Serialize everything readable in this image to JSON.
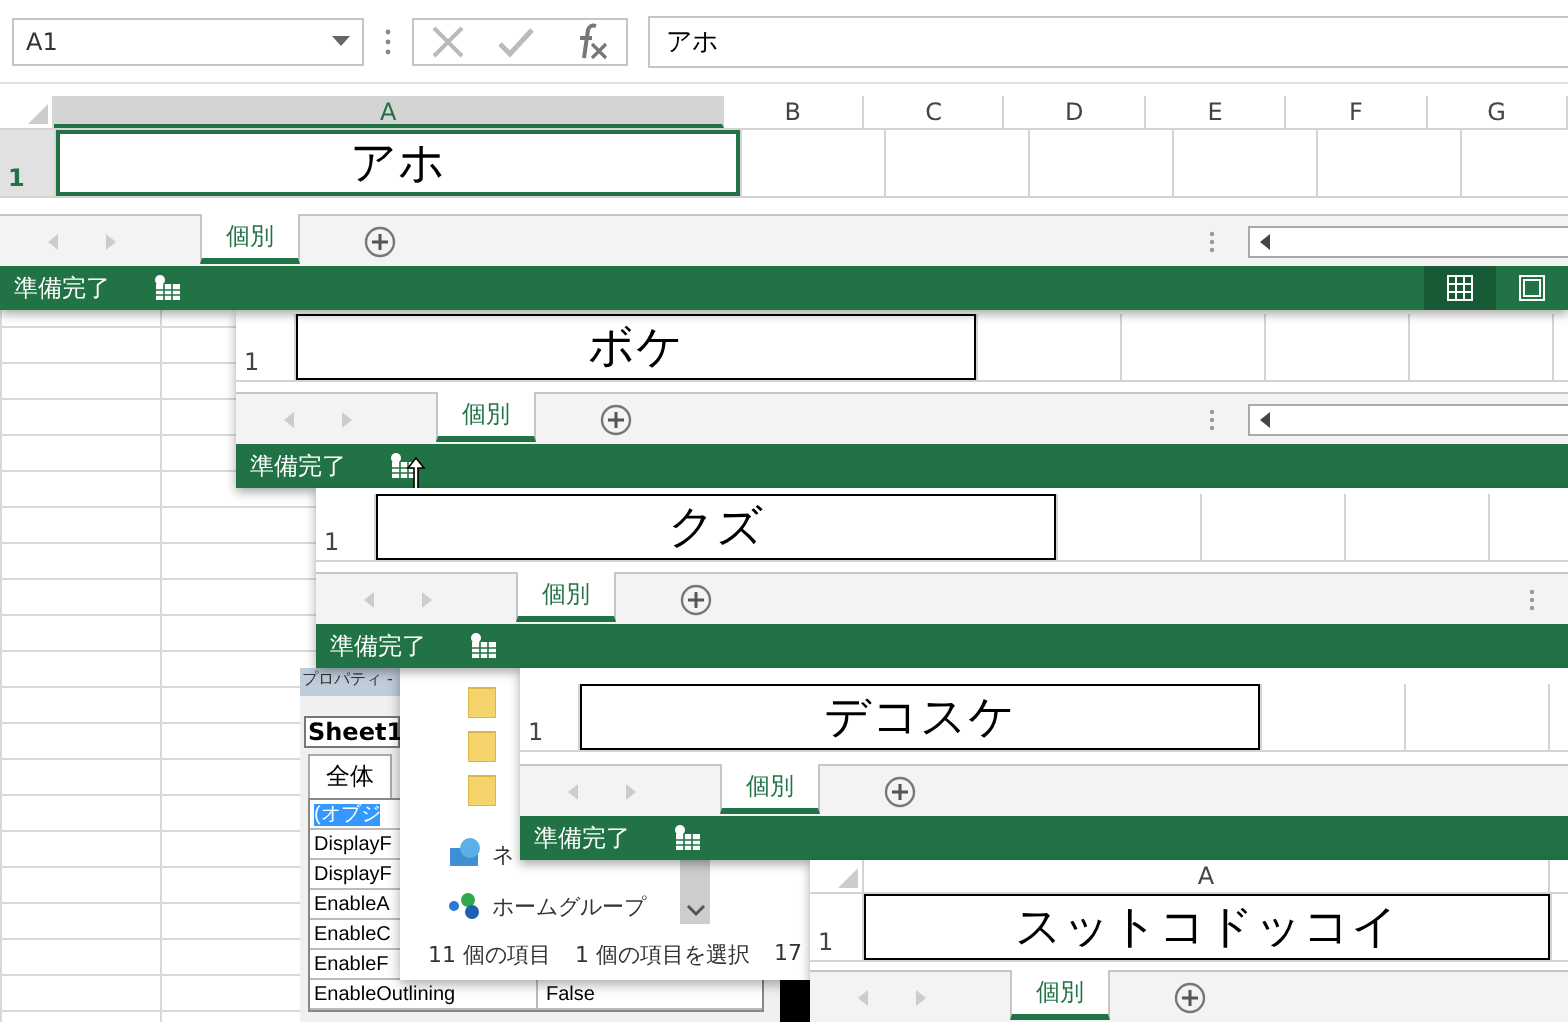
{
  "formula_bar": {
    "name_box": "A1",
    "value": "アホ"
  },
  "windows": [
    {
      "columns": [
        {
          "label": "A",
          "selected": true
        },
        {
          "label": "B",
          "selected": false
        },
        {
          "label": "C",
          "selected": false
        },
        {
          "label": "D",
          "selected": false
        },
        {
          "label": "E",
          "selected": false
        },
        {
          "label": "F",
          "selected": false
        },
        {
          "label": "G",
          "selected": false
        }
      ],
      "row_label": "1",
      "row_selected": true,
      "cell": "アホ",
      "tab": {
        "label": "個別",
        "selected": true
      },
      "hscroll": true,
      "status": "準備完了",
      "view_buttons": [
        {
          "kind": "normal",
          "selected": true
        },
        {
          "kind": "page",
          "selected": false
        }
      ]
    },
    {
      "row_label": "1",
      "row_selected": false,
      "cell": "ボケ",
      "tab": {
        "label": "個別",
        "selected": true
      },
      "hscroll": true,
      "status": "準備完了",
      "resize_cursor": true
    },
    {
      "row_label": "1",
      "row_selected": false,
      "cell": "クズ",
      "tab": {
        "label": "個別",
        "selected": true
      },
      "hscroll": false,
      "status": "準備完了"
    },
    {
      "row_label": "1",
      "row_selected": false,
      "cell": "デコスケ",
      "tab": {
        "label": "個別",
        "selected": true
      },
      "hscroll": false,
      "status": "準備完了"
    },
    {
      "columns": [
        {
          "label": "A",
          "selected": false
        }
      ],
      "row_label": "1",
      "row_selected": false,
      "cell": "スットコドッコイ",
      "tab": {
        "label": "個別",
        "selected": true
      },
      "hscroll": false
    }
  ],
  "properties": {
    "title": "プロパティ -",
    "object": "Sheet1",
    "tabs": [
      {
        "label": "全体",
        "selected": true
      }
    ],
    "rows": [
      {
        "name": "(オブジ",
        "selected": true
      },
      {
        "name": "DisplayF",
        "selected": false
      },
      {
        "name": "DisplayF",
        "selected": false
      },
      {
        "name": "EnableA",
        "selected": false
      },
      {
        "name": "EnableC",
        "selected": false
      },
      {
        "name": "EnableF",
        "selected": false
      },
      {
        "name": "EnableOutlining",
        "value": "False",
        "selected": false
      }
    ]
  },
  "explorer": {
    "items": [
      {
        "kind": "folder"
      },
      {
        "kind": "folder"
      },
      {
        "kind": "folder"
      },
      {
        "kind": "network",
        "label": "ネ"
      },
      {
        "kind": "homegroup",
        "label": "ホームグループ"
      }
    ],
    "status": [
      "11 個の項目",
      "1 個の項目を選択",
      "17"
    ]
  }
}
